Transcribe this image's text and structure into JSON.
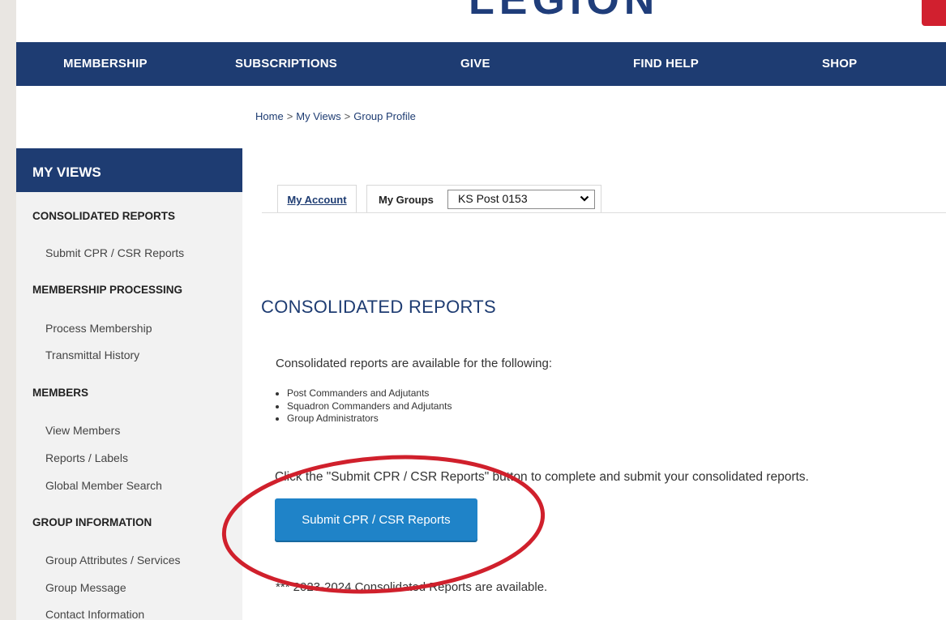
{
  "header": {
    "logo_text": "LEGION",
    "nav": [
      {
        "label": "MEMBERSHIP"
      },
      {
        "label": "SUBSCRIPTIONS"
      },
      {
        "label": "GIVE"
      },
      {
        "label": "FIND HELP"
      },
      {
        "label": "SHOP"
      }
    ]
  },
  "breadcrumb": [
    "Home",
    "My Views",
    "Group Profile"
  ],
  "breadcrumb_separator": ">",
  "sidebar": {
    "title": "MY VIEWS",
    "sections": [
      {
        "title": "CONSOLIDATED REPORTS",
        "items": [
          "Submit CPR / CSR Reports"
        ]
      },
      {
        "title": "MEMBERSHIP PROCESSING",
        "items": [
          "Process Membership",
          "Transmittal History"
        ]
      },
      {
        "title": "MEMBERS",
        "items": [
          "View Members",
          "Reports / Labels",
          "Global Member Search"
        ]
      },
      {
        "title": "GROUP INFORMATION",
        "items": [
          "Group Attributes / Services",
          "Group Message",
          "Contact Information"
        ]
      }
    ]
  },
  "tabs": {
    "my_account": "My Account",
    "my_groups": "My Groups",
    "group_select_value": "KS Post 0153"
  },
  "main": {
    "title": "CONSOLIDATED REPORTS",
    "intro": "Consolidated reports are available for the following:",
    "bullets": [
      "Post Commanders and Adjutants",
      "Squadron Commanders and Adjutants",
      "Group Administrators"
    ],
    "instruction": "Click the \"Submit CPR / CSR Reports\" button to complete and submit your consolidated reports.",
    "submit_button": "Submit CPR / CSR Reports",
    "note": "*** 2023-2024 Consolidated Reports are available."
  },
  "colors": {
    "navy": "#1e3c72",
    "button_blue": "#1f83c8",
    "annotation_red": "#d0202c",
    "logo_red": "#d1202f"
  }
}
